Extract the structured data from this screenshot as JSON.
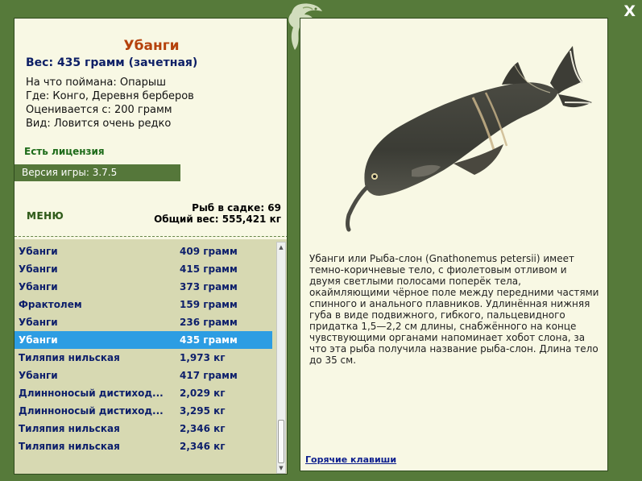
{
  "window": {
    "close_label": "X"
  },
  "fish": {
    "title": "Убанги",
    "weight": "Вес: 435 грамм (зачетная)",
    "bait": "На что поймана: Опарыш",
    "place": "Где: Конго, Деревня берберов",
    "value": "Оценивается с: 200 грамм",
    "kind": "Вид: Ловится очень редко"
  },
  "license": "Есть лицензия",
  "version": "Версия игры: 3.7.5",
  "menu": "МЕНЮ",
  "stats": {
    "count": "Рыб в садке: 69",
    "total": "Общий вес: 555,421 кг"
  },
  "catches": [
    {
      "name": "Убанги",
      "weight": "409 грамм"
    },
    {
      "name": "Убанги",
      "weight": "415 грамм"
    },
    {
      "name": "Убанги",
      "weight": "373 грамм"
    },
    {
      "name": "Фрактолем",
      "weight": "159 грамм"
    },
    {
      "name": "Убанги",
      "weight": "236 грамм"
    },
    {
      "name": "Убанги",
      "weight": "435 грамм"
    },
    {
      "name": "Тиляпия нильская",
      "weight": "1,973 кг"
    },
    {
      "name": "Убанги",
      "weight": "417 грамм"
    },
    {
      "name": "Длинноносый дистиход...",
      "weight": "2,029 кг"
    },
    {
      "name": "Длинноносый дистиход...",
      "weight": "3,295 кг"
    },
    {
      "name": "Тиляпия нильская",
      "weight": "2,346 кг"
    },
    {
      "name": "Тиляпия нильская",
      "weight": "2,346 кг"
    }
  ],
  "selected_index": 5,
  "description": "Убанги или Рыба-слон (Gnathonemus petersii) имеет темно-коричневые тело, с фиолетовым отливом и двумя светлыми полосами поперёк тела, окаймляющими чёрное поле между передними частями спинного и анального плавников. Удлинённая нижняя губа в виде подвижного, гибкого, пальцевидного придатка 1,5—2,2 см длины, снабжённого на конце чувствующими органами напоминает хобот слона, за что эта рыба получила название рыба-слон. Длина тело до 35 см.",
  "hotkeys": "Горячие клавиши",
  "colors": {
    "frame": "#567a3a",
    "panel": "#f8f8e4",
    "list_bg": "#d7d9b2",
    "selected": "#2d9de3",
    "title": "#b5420c",
    "text_blue": "#0d1f6b"
  },
  "icons": {
    "close": "close-icon",
    "decoration": "lizard-ornament-icon",
    "picture": "elephant-fish-image"
  }
}
